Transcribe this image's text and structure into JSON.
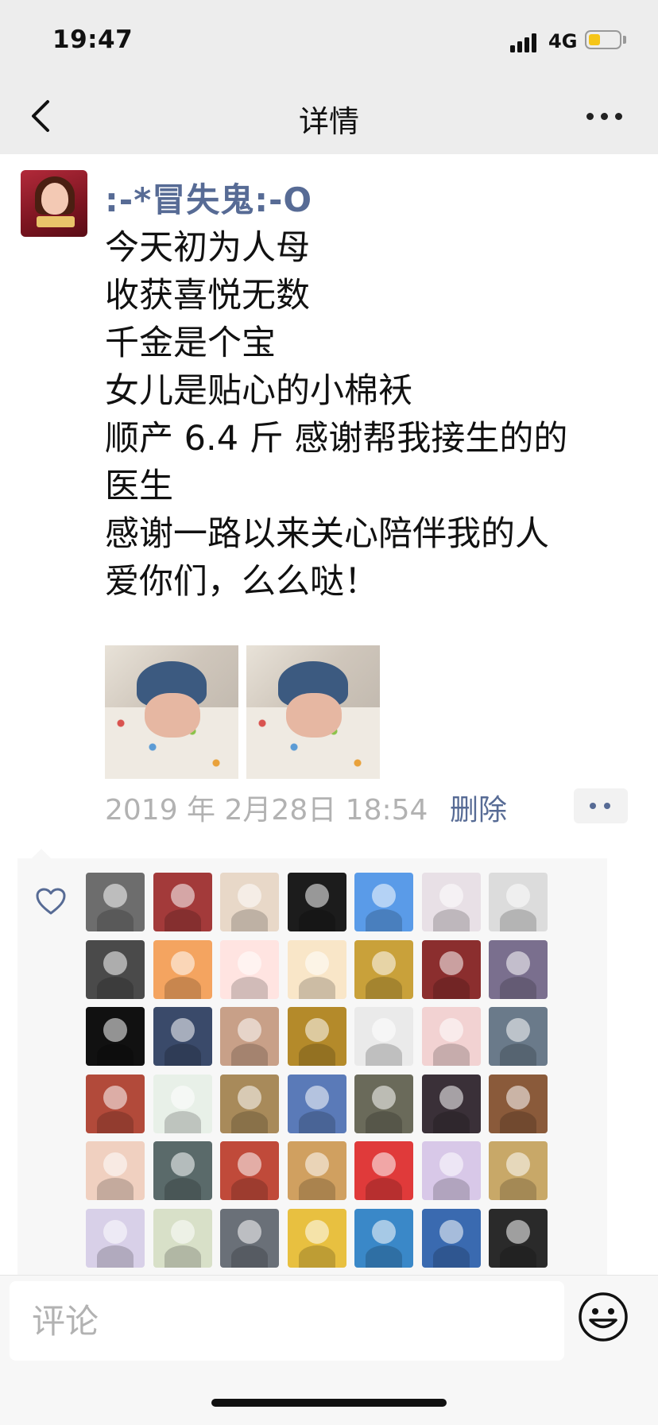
{
  "status_bar": {
    "time": "19:47",
    "network": "4G",
    "battery_color": "#f5c518"
  },
  "nav": {
    "title": "详情",
    "back_icon": "chevron-left-icon",
    "more_icon": "more-dots-icon"
  },
  "post": {
    "author": ":-*冒失鬼:-O",
    "lines": [
      "今天初为人母",
      "收获喜悦无数",
      "千金是个宝",
      "女儿是贴心的小棉袄",
      "顺产 6.4 斤 感谢帮我接生的的",
      "医生",
      "感谢一路以来关心陪伴我的人",
      "爱你们，么么哒！"
    ],
    "photos": [
      "baby-photo",
      "baby-photo"
    ],
    "timestamp": "2019 年 2月28日 18:54",
    "delete_label": "删除"
  },
  "likes": {
    "icon": "heart-icon",
    "avatar_count": 42
  },
  "comment": {
    "placeholder": "评论",
    "value": "",
    "emoji_icon": "smiley-icon"
  },
  "colors": {
    "link": "#576b95",
    "nav_bg": "#ededed",
    "panel_bg": "#f7f7f7",
    "meta": "#b2b2b2"
  }
}
